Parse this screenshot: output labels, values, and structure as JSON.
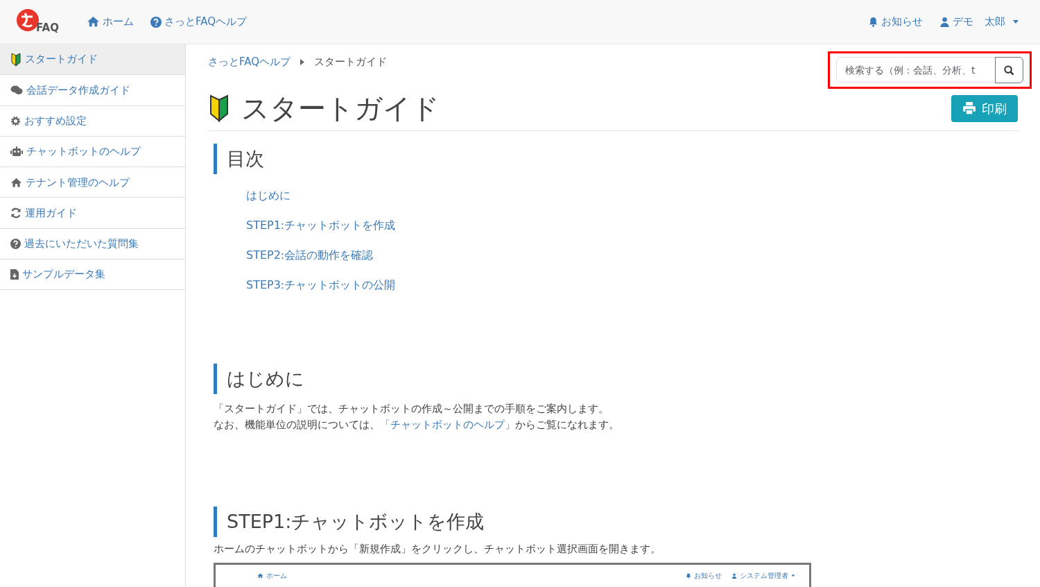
{
  "navbar": {
    "logo_text": "FAQ",
    "links": [
      "ホーム",
      "さっとFAQヘルプ"
    ],
    "notifications": "お知らせ",
    "user": {
      "first": "デモ",
      "last": "太郎"
    }
  },
  "sidebar": {
    "items": [
      {
        "label": "スタートガイド",
        "selected": true
      },
      {
        "label": "会話データ作成ガイド",
        "selected": false
      },
      {
        "label": "おすすめ設定",
        "selected": false
      },
      {
        "label": "チャットボットのヘルプ",
        "selected": false
      },
      {
        "label": "テナント管理のヘルプ",
        "selected": false
      },
      {
        "label": "運用ガイド",
        "selected": false
      },
      {
        "label": "過去にいただいた質問集",
        "selected": false
      },
      {
        "label": "サンプルデータ集",
        "selected": false
      }
    ]
  },
  "breadcrumb": [
    "さっとFAQヘルプ",
    "スタートガイド"
  ],
  "search": {
    "placeholder": "検索する（例：会話、分析、t",
    "highlighted": true
  },
  "title": "スタートガイド",
  "print_button": "印刷",
  "toc": {
    "heading": "目次",
    "items": [
      "はじめに",
      "STEP1:チャットボットを作成",
      "STEP2:会話の動作を確認",
      "STEP3:チャットボットの公開"
    ]
  },
  "sections": [
    {
      "heading": "はじめに",
      "paragraphs": [
        {
          "text": "「スタートガイド」では、チャットボットの作成～公開までの手順をご案内します。"
        },
        {
          "text": "なお、機能単位の説明については、",
          "link": "「チャットボットのヘルプ」",
          "after": "からご覧になれます。"
        }
      ]
    },
    {
      "heading": "STEP1:チャットボットを作成",
      "paragraphs": [
        {
          "text": "ホームのチャットボットから「新規作成」をクリックし、チャットボット選択画面を開きます。"
        }
      ],
      "screenshot": {
        "home": "ホーム",
        "notifications": "お知らせ",
        "user": "システム管理者"
      }
    }
  ]
}
